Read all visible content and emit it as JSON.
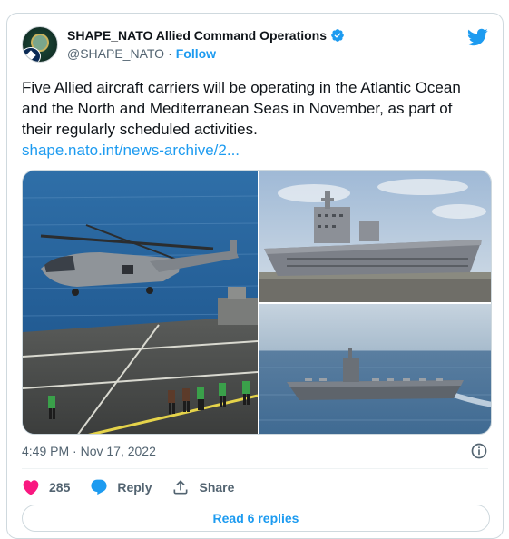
{
  "account": {
    "name": "SHAPE_NATO Allied Command Operations",
    "handle": "@SHAPE_NATO",
    "separator": "·",
    "follow_label": "Follow",
    "avatar_text": "NATO OTAN"
  },
  "tweet": {
    "text": "Five Allied aircraft carriers will be operating in the Atlantic Ocean and the North and Mediterranean Seas in November, as part of their regularly scheduled activities.",
    "link": "shape.nato.int/news-archive/2..."
  },
  "media": {
    "images": [
      {
        "icon": "helicopter-on-carrier-deck-photo"
      },
      {
        "icon": "aircraft-carrier-at-pier-photo"
      },
      {
        "icon": "aircraft-carrier-at-sea-photo"
      }
    ]
  },
  "meta": {
    "timestamp": "4:49 PM · Nov 17, 2022"
  },
  "actions": {
    "likes_count": "285",
    "reply_label": "Reply",
    "share_label": "Share"
  },
  "read_replies_label": "Read 6 replies",
  "colors": {
    "accent": "#1d9bf0",
    "heart": "#f91880",
    "text": "#0f1419",
    "muted": "#536471",
    "border": "#cfd9de"
  }
}
